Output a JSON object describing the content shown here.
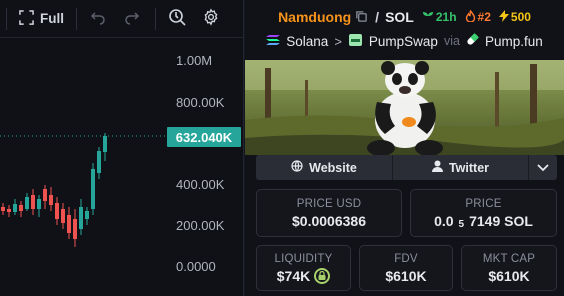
{
  "toolbar": {
    "full_label": "Full",
    "icons": [
      "fullscreen-icon",
      "undo-icon",
      "redo-icon",
      "zoom-reset-icon",
      "gear-icon"
    ]
  },
  "chart": {
    "price_axis": [
      "1.00M",
      "800.00K",
      "400.00K",
      "200.00K",
      "0.0000"
    ],
    "current_price_tag": "632.040K",
    "colors": {
      "up": "#26a69a",
      "down": "#ef5350",
      "background": "#0f1117"
    }
  },
  "header": {
    "token_name": "Namduong",
    "quote": "SOL",
    "age": "21h",
    "rank": "#2",
    "boosts": "500",
    "chain": "Solana",
    "dex": "PumpSwap",
    "via_label": "via",
    "launchpad": "Pump.fun"
  },
  "links": {
    "website": "Website",
    "twitter": "Twitter"
  },
  "stats": {
    "price_usd_label": "PRICE USD",
    "price_usd": "$0.0006386",
    "price_native_label": "PRICE",
    "price_native_prefix": "0.0",
    "price_native_zeros": "5",
    "price_native_rest": "7149 SOL",
    "liquidity_label": "LIQUIDITY",
    "liquidity": "$74K",
    "fdv_label": "FDV",
    "fdv": "$610K",
    "mktcap_label": "MKT CAP",
    "mktcap": "$610K"
  }
}
